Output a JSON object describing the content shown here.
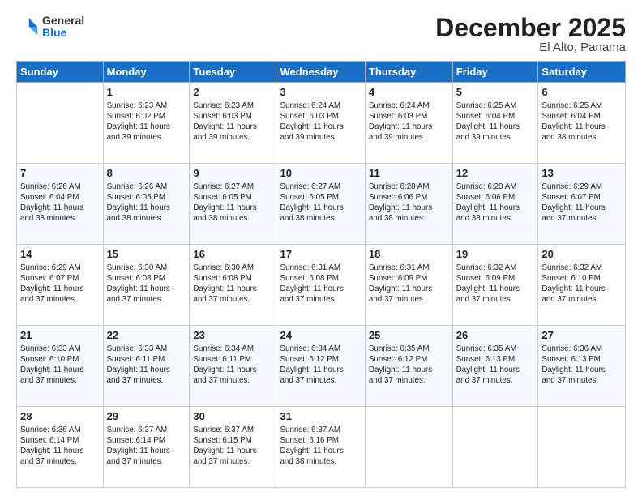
{
  "header": {
    "logo_general": "General",
    "logo_blue": "Blue",
    "month_title": "December 2025",
    "location": "El Alto, Panama"
  },
  "weekdays": [
    "Sunday",
    "Monday",
    "Tuesday",
    "Wednesday",
    "Thursday",
    "Friday",
    "Saturday"
  ],
  "weeks": [
    [
      {
        "num": "",
        "info": ""
      },
      {
        "num": "1",
        "info": "Sunrise: 6:23 AM\nSunset: 6:02 PM\nDaylight: 11 hours\nand 39 minutes."
      },
      {
        "num": "2",
        "info": "Sunrise: 6:23 AM\nSunset: 6:03 PM\nDaylight: 11 hours\nand 39 minutes."
      },
      {
        "num": "3",
        "info": "Sunrise: 6:24 AM\nSunset: 6:03 PM\nDaylight: 11 hours\nand 39 minutes."
      },
      {
        "num": "4",
        "info": "Sunrise: 6:24 AM\nSunset: 6:03 PM\nDaylight: 11 hours\nand 39 minutes."
      },
      {
        "num": "5",
        "info": "Sunrise: 6:25 AM\nSunset: 6:04 PM\nDaylight: 11 hours\nand 39 minutes."
      },
      {
        "num": "6",
        "info": "Sunrise: 6:25 AM\nSunset: 6:04 PM\nDaylight: 11 hours\nand 38 minutes."
      }
    ],
    [
      {
        "num": "7",
        "info": "Sunrise: 6:26 AM\nSunset: 6:04 PM\nDaylight: 11 hours\nand 38 minutes."
      },
      {
        "num": "8",
        "info": "Sunrise: 6:26 AM\nSunset: 6:05 PM\nDaylight: 11 hours\nand 38 minutes."
      },
      {
        "num": "9",
        "info": "Sunrise: 6:27 AM\nSunset: 6:05 PM\nDaylight: 11 hours\nand 38 minutes."
      },
      {
        "num": "10",
        "info": "Sunrise: 6:27 AM\nSunset: 6:05 PM\nDaylight: 11 hours\nand 38 minutes."
      },
      {
        "num": "11",
        "info": "Sunrise: 6:28 AM\nSunset: 6:06 PM\nDaylight: 11 hours\nand 38 minutes."
      },
      {
        "num": "12",
        "info": "Sunrise: 6:28 AM\nSunset: 6:06 PM\nDaylight: 11 hours\nand 38 minutes."
      },
      {
        "num": "13",
        "info": "Sunrise: 6:29 AM\nSunset: 6:07 PM\nDaylight: 11 hours\nand 37 minutes."
      }
    ],
    [
      {
        "num": "14",
        "info": "Sunrise: 6:29 AM\nSunset: 6:07 PM\nDaylight: 11 hours\nand 37 minutes."
      },
      {
        "num": "15",
        "info": "Sunrise: 6:30 AM\nSunset: 6:08 PM\nDaylight: 11 hours\nand 37 minutes."
      },
      {
        "num": "16",
        "info": "Sunrise: 6:30 AM\nSunset: 6:08 PM\nDaylight: 11 hours\nand 37 minutes."
      },
      {
        "num": "17",
        "info": "Sunrise: 6:31 AM\nSunset: 6:08 PM\nDaylight: 11 hours\nand 37 minutes."
      },
      {
        "num": "18",
        "info": "Sunrise: 6:31 AM\nSunset: 6:09 PM\nDaylight: 11 hours\nand 37 minutes."
      },
      {
        "num": "19",
        "info": "Sunrise: 6:32 AM\nSunset: 6:09 PM\nDaylight: 11 hours\nand 37 minutes."
      },
      {
        "num": "20",
        "info": "Sunrise: 6:32 AM\nSunset: 6:10 PM\nDaylight: 11 hours\nand 37 minutes."
      }
    ],
    [
      {
        "num": "21",
        "info": "Sunrise: 6:33 AM\nSunset: 6:10 PM\nDaylight: 11 hours\nand 37 minutes."
      },
      {
        "num": "22",
        "info": "Sunrise: 6:33 AM\nSunset: 6:11 PM\nDaylight: 11 hours\nand 37 minutes."
      },
      {
        "num": "23",
        "info": "Sunrise: 6:34 AM\nSunset: 6:11 PM\nDaylight: 11 hours\nand 37 minutes."
      },
      {
        "num": "24",
        "info": "Sunrise: 6:34 AM\nSunset: 6:12 PM\nDaylight: 11 hours\nand 37 minutes."
      },
      {
        "num": "25",
        "info": "Sunrise: 6:35 AM\nSunset: 6:12 PM\nDaylight: 11 hours\nand 37 minutes."
      },
      {
        "num": "26",
        "info": "Sunrise: 6:35 AM\nSunset: 6:13 PM\nDaylight: 11 hours\nand 37 minutes."
      },
      {
        "num": "27",
        "info": "Sunrise: 6:36 AM\nSunset: 6:13 PM\nDaylight: 11 hours\nand 37 minutes."
      }
    ],
    [
      {
        "num": "28",
        "info": "Sunrise: 6:36 AM\nSunset: 6:14 PM\nDaylight: 11 hours\nand 37 minutes."
      },
      {
        "num": "29",
        "info": "Sunrise: 6:37 AM\nSunset: 6:14 PM\nDaylight: 11 hours\nand 37 minutes."
      },
      {
        "num": "30",
        "info": "Sunrise: 6:37 AM\nSunset: 6:15 PM\nDaylight: 11 hours\nand 37 minutes."
      },
      {
        "num": "31",
        "info": "Sunrise: 6:37 AM\nSunset: 6:16 PM\nDaylight: 11 hours\nand 38 minutes."
      },
      {
        "num": "",
        "info": ""
      },
      {
        "num": "",
        "info": ""
      },
      {
        "num": "",
        "info": ""
      }
    ]
  ]
}
